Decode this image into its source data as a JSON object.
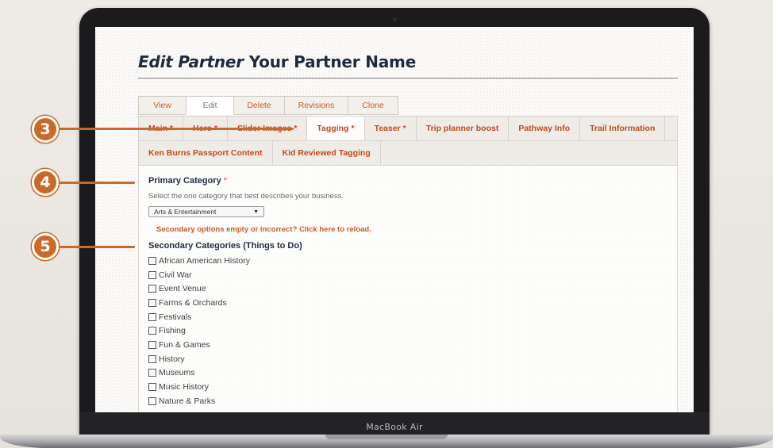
{
  "page": {
    "title_prefix": "Edit Partner",
    "title_name": "Your Partner Name"
  },
  "primary_tabs": [
    {
      "label": "View",
      "active": false
    },
    {
      "label": "Edit",
      "active": true
    },
    {
      "label": "Delete",
      "active": false
    },
    {
      "label": "Revisions",
      "active": false
    },
    {
      "label": "Clone",
      "active": false
    }
  ],
  "secondary_tabs": {
    "row1": [
      {
        "label": "Main",
        "required": true
      },
      {
        "label": "Hero",
        "required": true
      },
      {
        "label": "Slider Images",
        "required": true
      },
      {
        "label": "Tagging",
        "required": true,
        "active": true
      },
      {
        "label": "Teaser",
        "required": true
      },
      {
        "label": "Trip planner boost",
        "required": false
      },
      {
        "label": "Pathway Info",
        "required": false
      },
      {
        "label": "Trail Information",
        "required": false
      }
    ],
    "row2": [
      {
        "label": "Ken Burns Passport Content"
      },
      {
        "label": "Kid Reviewed Tagging"
      }
    ],
    "required_marker": "*"
  },
  "form": {
    "primary_category": {
      "label": "Primary Category",
      "required_marker": "*",
      "help": "Select the one category that best describes your business.",
      "selected": "Arts & Entertainment"
    },
    "reload_warning": "Secondary options empty or incorrect? Click here to reload.",
    "secondary_categories": {
      "label": "Secondary Categories (Things to Do)",
      "options": [
        "African American History",
        "Civil War",
        "Event Venue",
        "Farms & Orchards",
        "Festivals",
        "Fishing",
        "Fun & Games",
        "History",
        "Museums",
        "Music History",
        "Nature & Parks"
      ]
    }
  },
  "callouts": [
    "3",
    "4",
    "5"
  ],
  "device": {
    "label": "MacBook Air"
  },
  "colors": {
    "accent": "#c96a28",
    "link": "#c04a1c",
    "heading": "#1e2b3d"
  }
}
